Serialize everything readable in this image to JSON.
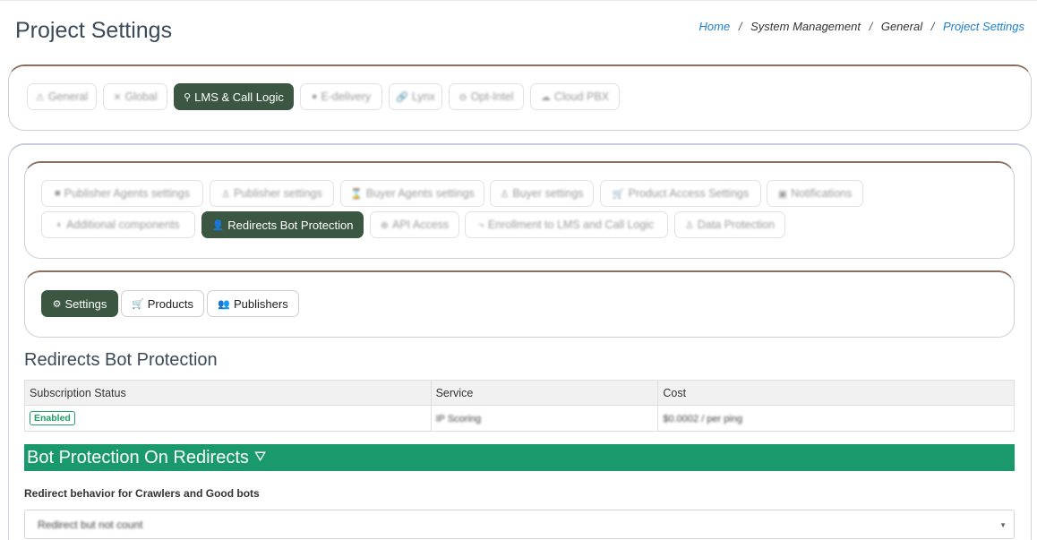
{
  "page": {
    "title": "Project Settings"
  },
  "breadcrumb": {
    "home": "Home",
    "system_management": "System Management",
    "general": "General",
    "current": "Project Settings",
    "separator": "/"
  },
  "top_tabs": [
    {
      "label": "General",
      "icon": "⚠"
    },
    {
      "label": "Global",
      "icon": "✕"
    },
    {
      "label": "LMS & Call Logic",
      "icon": "⚲",
      "active": true
    },
    {
      "label": "E-delivery",
      "icon": "●"
    },
    {
      "label": "Lynx",
      "icon": "🔗"
    },
    {
      "label": "Opt-Intel",
      "icon": "⊖"
    },
    {
      "label": "Cloud PBX",
      "icon": "☁"
    }
  ],
  "sub_tabs": [
    {
      "label": "Publisher Agents settings",
      "icon": "■"
    },
    {
      "label": "Publisher settings",
      "icon": "♙"
    },
    {
      "label": "Buyer Agents settings",
      "icon": "⌛"
    },
    {
      "label": "Buyer settings",
      "icon": "♙"
    },
    {
      "label": "Product Access Settings",
      "icon": "🛒"
    },
    {
      "label": "Notifications",
      "icon": "▣"
    },
    {
      "label": "Additional components",
      "icon": "◐"
    },
    {
      "label": "Redirects Bot Protection",
      "icon": "👤",
      "active": true
    },
    {
      "label": "API Access",
      "icon": "⊕"
    },
    {
      "label": "Enrollment to LMS and Call Logic",
      "icon": "⤷"
    },
    {
      "label": "Data Protection",
      "icon": "♙"
    }
  ],
  "inner_tabs": [
    {
      "label": "Settings",
      "icon": "⚙",
      "active": true
    },
    {
      "label": "Products",
      "icon": "🛒"
    },
    {
      "label": "Publishers",
      "icon": "👥"
    }
  ],
  "section": {
    "title": "Redirects Bot Protection"
  },
  "subscription_table": {
    "headers": [
      "Subscription Status",
      "Service",
      "Cost"
    ],
    "row": {
      "status": "Enabled",
      "service": "IP Scoring",
      "cost": "$0.0002 / per ping"
    }
  },
  "banner": {
    "title": "Bot Protection On Redirects",
    "icon": "⛛"
  },
  "form": {
    "label": "Redirect behavior for Crawlers and Good bots",
    "value": "Redirect but not count"
  },
  "colors": {
    "active_tab": "#3b5742",
    "banner": "#1a9a6c",
    "link": "#1b7fd1",
    "card_edge": "#8b6f5e"
  }
}
